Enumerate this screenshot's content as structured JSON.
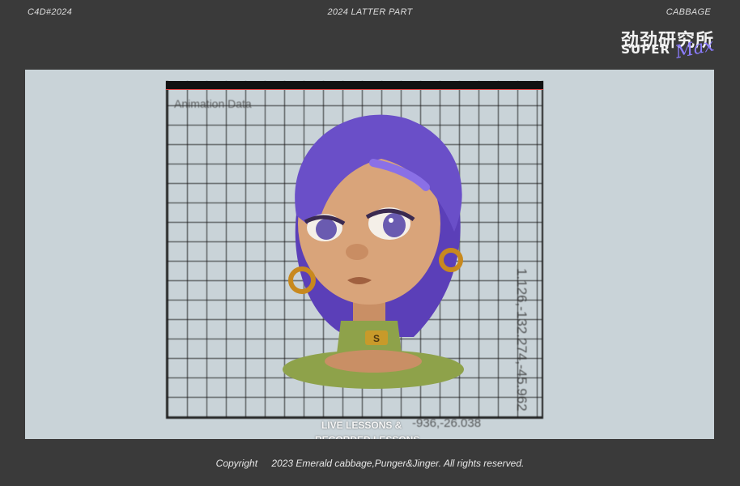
{
  "header": {
    "left": "C4D#2024",
    "center": "2024 LATTER PART",
    "right": "CABBAGE"
  },
  "logo": {
    "cn": "劲劲研究所",
    "super": "SUPER",
    "max": "Max"
  },
  "artwork": {
    "grid_title": "Animation Data",
    "side_data": "1.126,-132.274,-45.962",
    "bottom_data": "-936,-26.038",
    "lessons_line1": "LIVE LESSONS &",
    "lessons_line2": "RECORDED LESSONS",
    "badge_letter": "S"
  },
  "footer": {
    "copyright": "Copyright",
    "text": "2023 Emerald cabbage,Punger&Jinger. All rights reserved."
  },
  "colors": {
    "background": "#3a3a3a",
    "stage": "#c9d3d8",
    "hair": "#6a4fc8",
    "skin": "#d9a47a",
    "collar": "#8ea24a",
    "accent_max": "#8b7cff"
  }
}
